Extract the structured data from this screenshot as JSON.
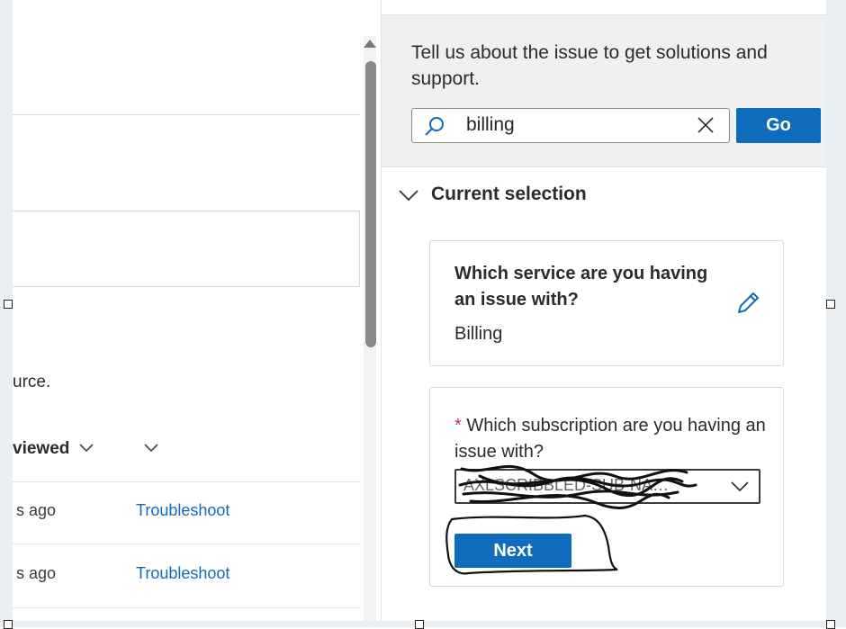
{
  "left": {
    "partial_text": "urce.",
    "column_header": "viewed",
    "rows": [
      {
        "time": "s ago",
        "action": "Troubleshoot"
      },
      {
        "time": "s ago",
        "action": "Troubleshoot"
      }
    ]
  },
  "panel": {
    "prompt": "Tell us about the issue to get solutions and support.",
    "search": {
      "value": "billing"
    },
    "go_label": "Go",
    "section_title": "Current selection",
    "card1": {
      "question": "Which service are you having an issue with?",
      "answer": "Billing"
    },
    "card2": {
      "required_mark": "*",
      "question": "Which subscription are you having an issue with?",
      "selected": "AXLSCRIBBLED-SUB-NA…",
      "next_label": "Next"
    }
  },
  "colors": {
    "accent": "#0f6cbd",
    "panel_gray": "#f0f0f0",
    "required": "#c4314b"
  },
  "icons": [
    "search-icon",
    "clear-icon",
    "chevron-down-icon",
    "edit-icon",
    "scroll-up-icon"
  ]
}
